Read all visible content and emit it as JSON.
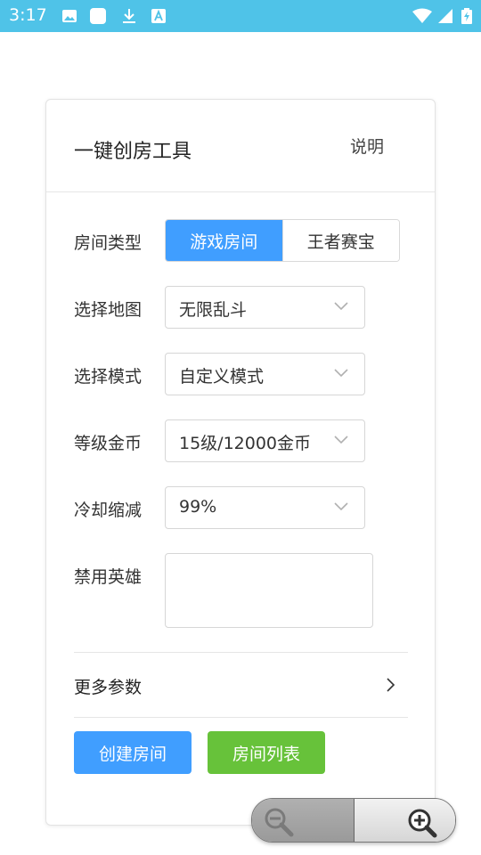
{
  "status_bar": {
    "time": "3:17",
    "icons": [
      "image-icon",
      "app-icon",
      "download-icon",
      "font-icon",
      "wifi-icon",
      "cellular-icon",
      "battery-charging-icon"
    ]
  },
  "card": {
    "title": "一键创房工具",
    "help": "说明"
  },
  "form": {
    "room_type": {
      "label": "房间类型",
      "options": [
        "游戏房间",
        "王者赛宝"
      ],
      "selected": "游戏房间"
    },
    "map": {
      "label": "选择地图",
      "value": "无限乱斗"
    },
    "mode": {
      "label": "选择模式",
      "value": "自定义模式"
    },
    "level_gold": {
      "label": "等级金币",
      "value": "15级/12000金币"
    },
    "cooldown": {
      "label": "冷却缩减",
      "value": "99%"
    },
    "banned_heroes": {
      "label": "禁用英雄",
      "value": ""
    }
  },
  "more_params": {
    "label": "更多参数"
  },
  "buttons": {
    "create": "创建房间",
    "list": "房间列表"
  },
  "colors": {
    "status_bar": "#4fc3e8",
    "primary": "#409eff",
    "success": "#67c23a"
  }
}
